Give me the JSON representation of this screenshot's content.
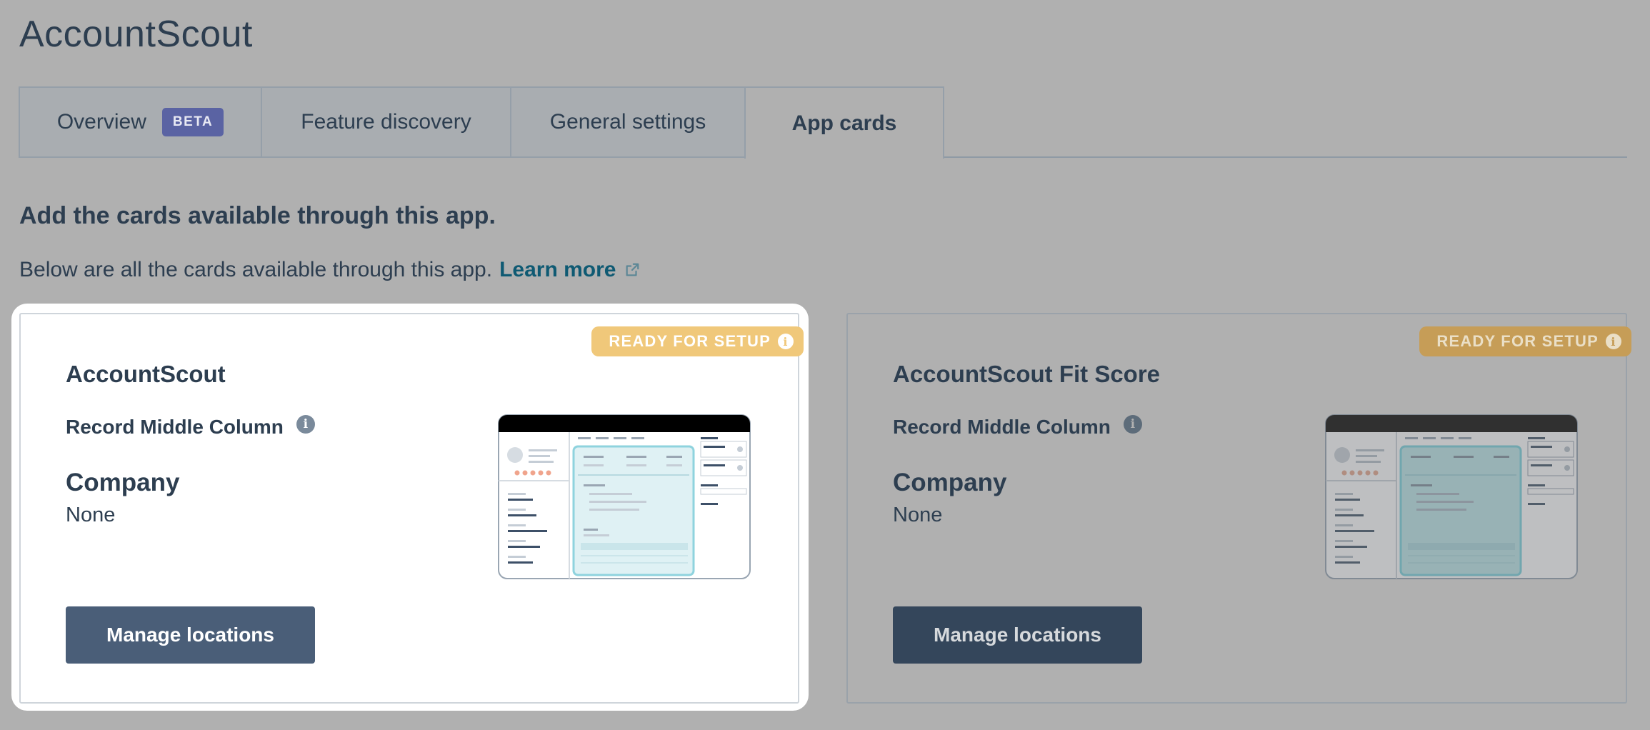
{
  "app_title": "AccountScout",
  "tabs": [
    {
      "label": "Overview",
      "badge": "BETA"
    },
    {
      "label": "Feature discovery"
    },
    {
      "label": "General settings"
    },
    {
      "label": "App cards",
      "active": true
    }
  ],
  "section": {
    "heading": "Add the cards available through this app.",
    "description": "Below are all the cards available through this app.",
    "learn_more": "Learn more"
  },
  "cards": [
    {
      "badge": "READY FOR SETUP",
      "title": "AccountScout",
      "location": "Record Middle Column",
      "object_label": "Company",
      "object_value": "None",
      "button": "Manage locations"
    },
    {
      "badge": "READY FOR SETUP",
      "title": "AccountScout Fit Score",
      "location": "Record Middle Column",
      "object_label": "Company",
      "object_value": "None",
      "button": "Manage locations"
    }
  ],
  "icons": {
    "external_link": "external-link-icon",
    "info": "info-icon"
  },
  "colors": {
    "overlay_bg": "#b0b0b0",
    "badge": "#f0c87a",
    "beta": "#5a63a3",
    "link": "#0f5a73",
    "button": "#4a5e78"
  }
}
